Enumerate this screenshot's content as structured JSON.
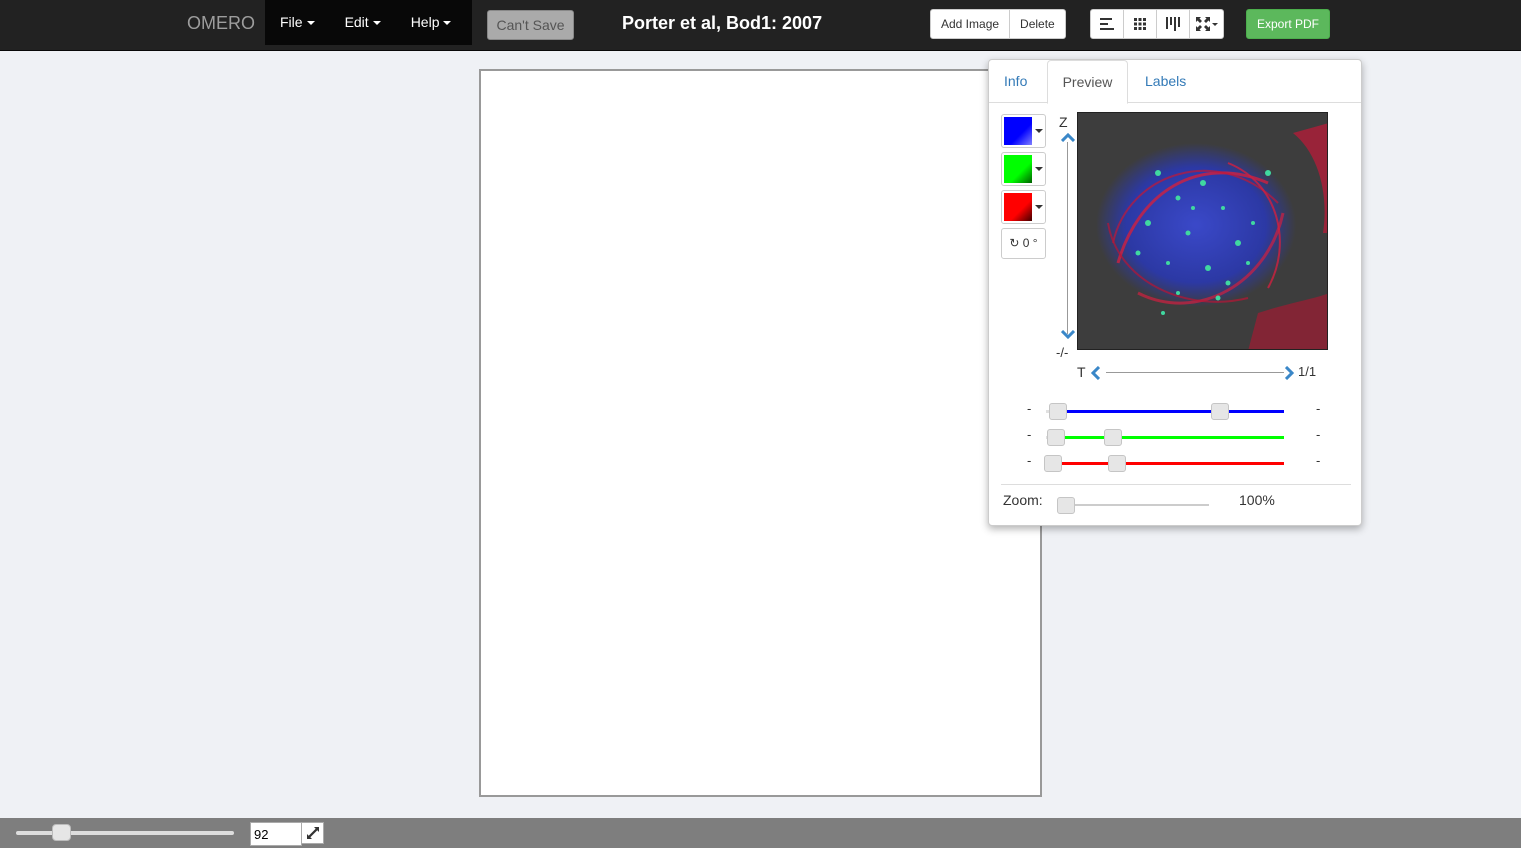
{
  "navbar": {
    "brand": "OMERO",
    "menus": [
      {
        "label": "File"
      },
      {
        "label": "Edit"
      },
      {
        "label": "Help"
      }
    ],
    "cant_save_label": "Can't Save",
    "title": "Porter et al, Bod1: 2007",
    "add_image_label": "Add Image",
    "delete_label": "Delete",
    "export_pdf_label": "Export PDF",
    "layout_icons": [
      "align-left-icon",
      "grid-icon",
      "align-vertical-icon",
      "fit-expand-icon"
    ]
  },
  "panel": {
    "tabs": [
      {
        "label": "Info",
        "active": false
      },
      {
        "label": "Preview",
        "active": true
      },
      {
        "label": "Labels",
        "active": false
      }
    ],
    "channels": [
      {
        "color": "#0000ff",
        "start_fraction": 0.05,
        "end_fraction": 0.73
      },
      {
        "color": "#00ff00",
        "start_fraction": 0.04,
        "end_fraction": 0.28
      },
      {
        "color": "#ff0000",
        "start_fraction": 0.03,
        "end_fraction": 0.3
      }
    ],
    "channel_dash": "-",
    "rotation_label": "0 °",
    "z_label": "Z",
    "z_value": "-/-",
    "t_label": "T",
    "t_value": "1/1",
    "zoom_label": "Zoom:",
    "zoom_value": "100%"
  },
  "footer": {
    "zoom_input_value": "92"
  }
}
